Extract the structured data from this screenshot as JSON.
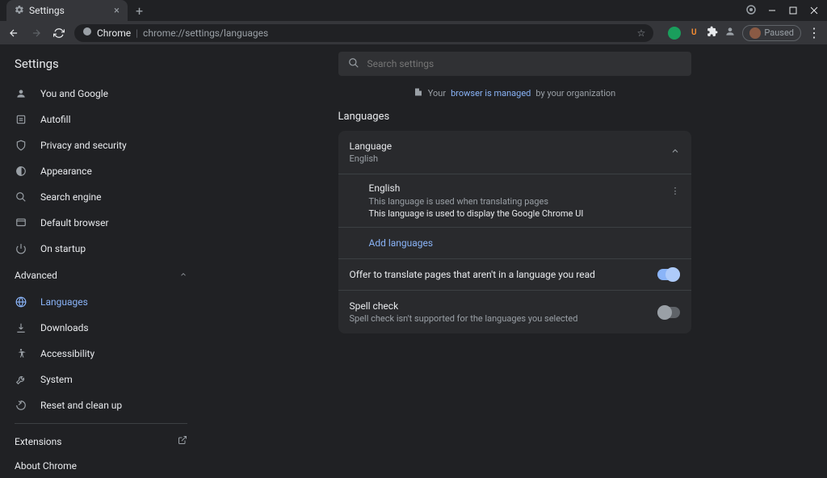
{
  "tab": {
    "title": "Settings"
  },
  "toolbar": {
    "chip": "Chrome",
    "url": "chrome://settings/languages",
    "paused": "Paused",
    "ext_u": "U"
  },
  "sidebar": {
    "title": "Settings",
    "items": [
      {
        "label": "You and Google"
      },
      {
        "label": "Autofill"
      },
      {
        "label": "Privacy and security"
      },
      {
        "label": "Appearance"
      },
      {
        "label": "Search engine"
      },
      {
        "label": "Default browser"
      },
      {
        "label": "On startup"
      }
    ],
    "advanced": "Advanced",
    "adv_items": [
      {
        "label": "Languages"
      },
      {
        "label": "Downloads"
      },
      {
        "label": "Accessibility"
      },
      {
        "label": "System"
      },
      {
        "label": "Reset and clean up"
      }
    ],
    "extensions": "Extensions",
    "about": "About Chrome"
  },
  "search": {
    "placeholder": "Search settings"
  },
  "banner": {
    "prefix": "Your ",
    "link": "browser is managed",
    "suffix": " by your organization"
  },
  "section": {
    "title": "Languages",
    "card": {
      "language_label": "Language",
      "language_value": "English",
      "lang_detail": {
        "name": "English",
        "note1": "This language is used when translating pages",
        "note2": "This language is used to display the Google Chrome UI"
      },
      "add_languages": "Add languages",
      "translate_row": "Offer to translate pages that aren't in a language you read",
      "spell_title": "Spell check",
      "spell_sub": "Spell check isn't supported for the languages you selected"
    }
  }
}
